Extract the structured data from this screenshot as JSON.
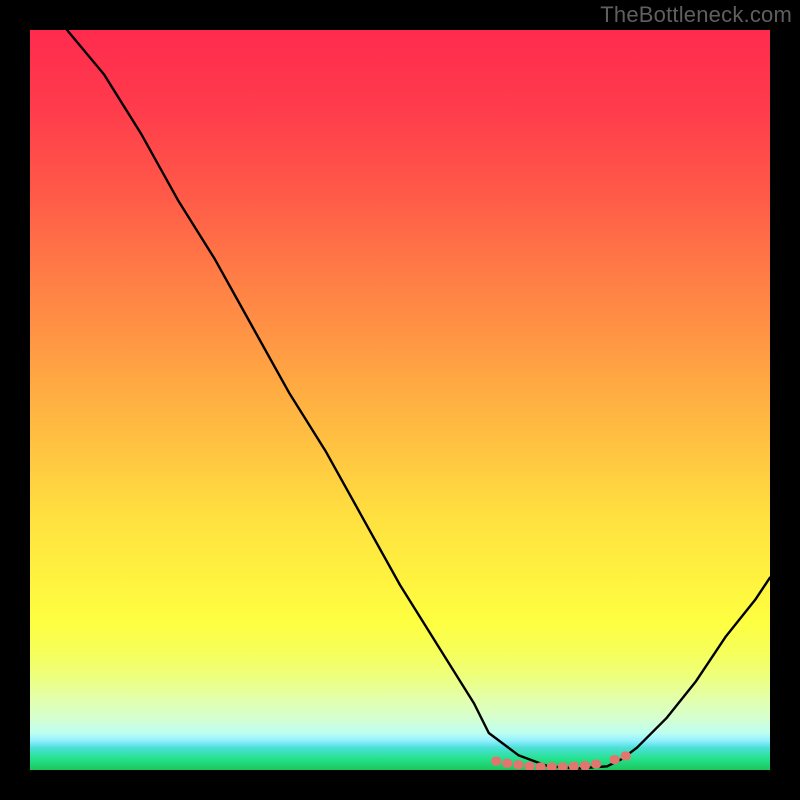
{
  "watermark": "TheBottleneck.com",
  "chart_data": {
    "type": "line",
    "title": "",
    "xlabel": "",
    "ylabel": "",
    "xlim": [
      0,
      100
    ],
    "ylim": [
      0,
      100
    ],
    "series": [
      {
        "name": "bottleneck-curve",
        "x": [
          5,
          10,
          15,
          20,
          25,
          30,
          35,
          40,
          45,
          50,
          55,
          60,
          62,
          66,
          70,
          74,
          78,
          80,
          82,
          86,
          90,
          94,
          98,
          100
        ],
        "values": [
          100,
          94,
          86,
          77,
          69,
          60,
          51,
          43,
          34,
          25,
          17,
          9,
          5,
          2,
          0.5,
          0.2,
          0.5,
          1.5,
          3,
          7,
          12,
          18,
          23,
          26
        ]
      }
    ],
    "markers": {
      "name": "optimal-zone-markers",
      "x": [
        63,
        64.5,
        66,
        67.5,
        69,
        70.5,
        72,
        73.5,
        75,
        76.5,
        79,
        80.5
      ],
      "values": [
        1.2,
        0.9,
        0.7,
        0.5,
        0.4,
        0.4,
        0.4,
        0.5,
        0.6,
        0.8,
        1.4,
        1.9
      ]
    },
    "gradient": {
      "top_color": "#ff2b4e",
      "mid_color": "#ffe140",
      "bottom_color": "#1cc65e"
    }
  }
}
